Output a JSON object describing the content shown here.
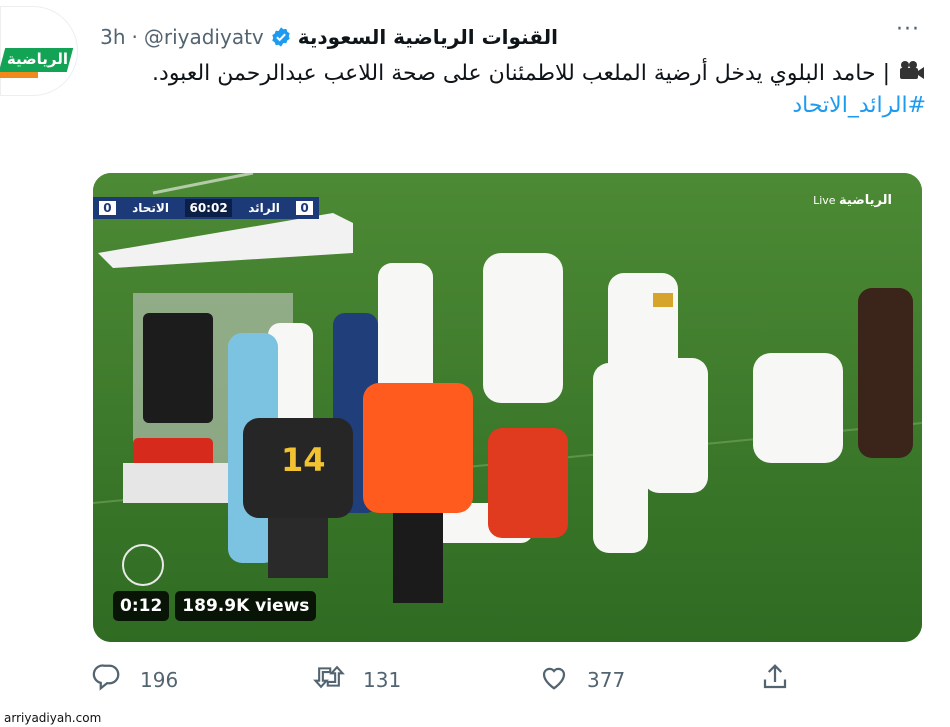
{
  "tweet": {
    "display_name": "القنوات الرياضية السعودية",
    "handle": "@riyadiyatv",
    "separator": "·",
    "time": "3h",
    "more": "···",
    "avatar_logo_text": "الرياضية",
    "text_line": "| حامد البلوي يدخل أرضية الملعب للاطمئنان على صحة اللاعب عبدالرحمن العبود.",
    "hashtag": "#الرائد_الاتحاد"
  },
  "video": {
    "score_home_team": "الرائد",
    "score_home": "0",
    "score_clock": "60:02",
    "score_away_team": "الاتحاد",
    "score_away": "0",
    "broadcast_live": "Live",
    "broadcast_logo": "الرياضية",
    "duration": "0:12",
    "views": "189.9K views",
    "player_number": "14"
  },
  "actions": {
    "reply_count": "196",
    "retweet_count": "131",
    "like_count": "377"
  },
  "footer": {
    "site": "arriyadiyah.com"
  },
  "colors": {
    "brand_green": "#12a355",
    "link_blue": "#1d9bf0",
    "verified_blue": "#1d9bf0",
    "muted": "#536471"
  },
  "icons": [
    "verified-badge-icon",
    "video-camera-icon",
    "reply-icon",
    "retweet-icon",
    "like-icon",
    "share-icon",
    "more-icon"
  ]
}
